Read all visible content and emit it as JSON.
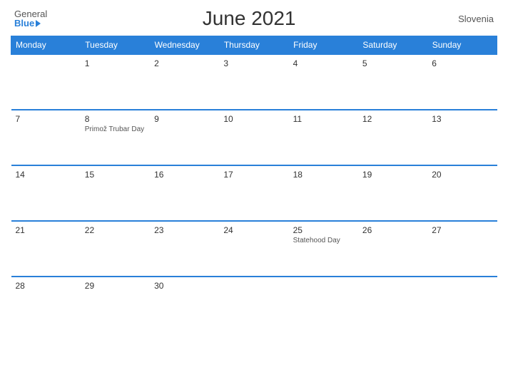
{
  "header": {
    "logo_general": "General",
    "logo_blue": "Blue",
    "title": "June 2021",
    "country": "Slovenia"
  },
  "weekdays": [
    "Monday",
    "Tuesday",
    "Wednesday",
    "Thursday",
    "Friday",
    "Saturday",
    "Sunday"
  ],
  "weeks": [
    [
      {
        "day": "",
        "holiday": "",
        "empty": true
      },
      {
        "day": "1",
        "holiday": "",
        "empty": false
      },
      {
        "day": "2",
        "holiday": "",
        "empty": false
      },
      {
        "day": "3",
        "holiday": "",
        "empty": false
      },
      {
        "day": "4",
        "holiday": "",
        "empty": false
      },
      {
        "day": "5",
        "holiday": "",
        "empty": false
      },
      {
        "day": "6",
        "holiday": "",
        "empty": false
      }
    ],
    [
      {
        "day": "7",
        "holiday": "",
        "empty": false
      },
      {
        "day": "8",
        "holiday": "Primož Trubar Day",
        "empty": false
      },
      {
        "day": "9",
        "holiday": "",
        "empty": false
      },
      {
        "day": "10",
        "holiday": "",
        "empty": false
      },
      {
        "day": "11",
        "holiday": "",
        "empty": false
      },
      {
        "day": "12",
        "holiday": "",
        "empty": false
      },
      {
        "day": "13",
        "holiday": "",
        "empty": false
      }
    ],
    [
      {
        "day": "14",
        "holiday": "",
        "empty": false
      },
      {
        "day": "15",
        "holiday": "",
        "empty": false
      },
      {
        "day": "16",
        "holiday": "",
        "empty": false
      },
      {
        "day": "17",
        "holiday": "",
        "empty": false
      },
      {
        "day": "18",
        "holiday": "",
        "empty": false
      },
      {
        "day": "19",
        "holiday": "",
        "empty": false
      },
      {
        "day": "20",
        "holiday": "",
        "empty": false
      }
    ],
    [
      {
        "day": "21",
        "holiday": "",
        "empty": false
      },
      {
        "day": "22",
        "holiday": "",
        "empty": false
      },
      {
        "day": "23",
        "holiday": "",
        "empty": false
      },
      {
        "day": "24",
        "holiday": "",
        "empty": false
      },
      {
        "day": "25",
        "holiday": "Statehood Day",
        "empty": false
      },
      {
        "day": "26",
        "holiday": "",
        "empty": false
      },
      {
        "day": "27",
        "holiday": "",
        "empty": false
      }
    ],
    [
      {
        "day": "28",
        "holiday": "",
        "empty": false
      },
      {
        "day": "29",
        "holiday": "",
        "empty": false
      },
      {
        "day": "30",
        "holiday": "",
        "empty": false
      },
      {
        "day": "",
        "holiday": "",
        "empty": true
      },
      {
        "day": "",
        "holiday": "",
        "empty": true
      },
      {
        "day": "",
        "holiday": "",
        "empty": true
      },
      {
        "day": "",
        "holiday": "",
        "empty": true
      }
    ]
  ]
}
